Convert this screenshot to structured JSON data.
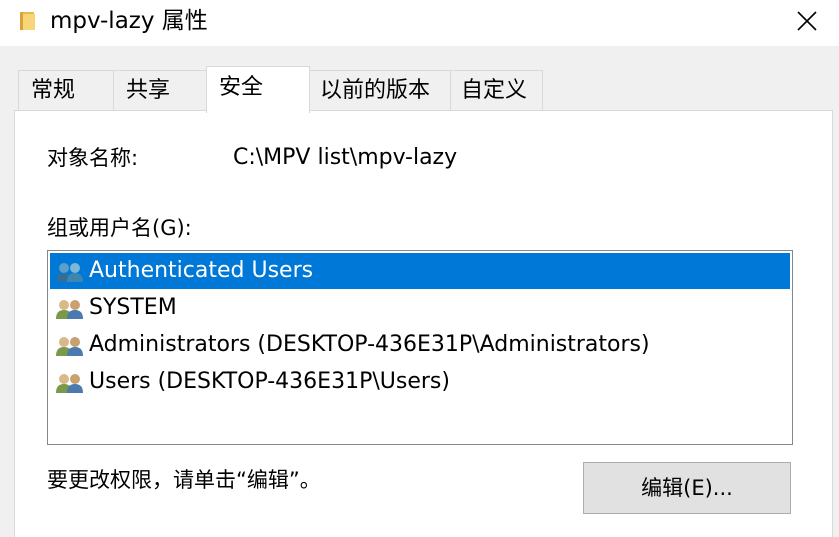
{
  "window": {
    "title": "mpv-lazy 属性"
  },
  "tabs": [
    {
      "label": "常规",
      "active": false
    },
    {
      "label": "共享",
      "active": false
    },
    {
      "label": "安全",
      "active": true
    },
    {
      "label": "以前的版本",
      "active": false
    },
    {
      "label": "自定义",
      "active": false
    }
  ],
  "security": {
    "object_name_label": "对象名称:",
    "object_name_value": "C:\\MPV list\\mpv-lazy",
    "group_label": "组或用户名(G):",
    "groups": [
      {
        "name": "Authenticated Users",
        "icon": "users-group-icon",
        "selected": true
      },
      {
        "name": "SYSTEM",
        "icon": "user-pair-icon",
        "selected": false
      },
      {
        "name": "Administrators (DESKTOP-436E31P\\Administrators)",
        "icon": "user-pair-icon",
        "selected": false
      },
      {
        "name": "Users (DESKTOP-436E31P\\Users)",
        "icon": "user-pair-icon",
        "selected": false
      }
    ],
    "change_hint": "要更改权限，请单击“编辑”。",
    "edit_button": "编辑(E)..."
  },
  "colors": {
    "selection": "#0078d7",
    "panel": "#ffffff",
    "window": "#f0f0f0"
  }
}
